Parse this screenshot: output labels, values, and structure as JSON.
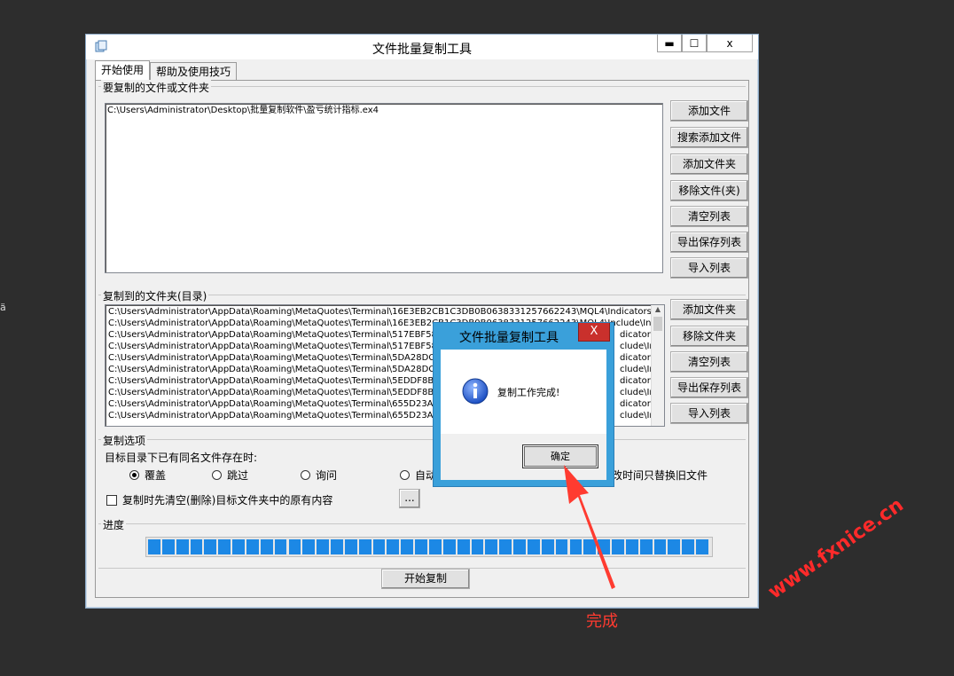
{
  "window": {
    "title": "文件批量复制工具",
    "controls": {
      "minimize": "▬",
      "maximize": "☐",
      "close": "x"
    }
  },
  "edge_text": "ä",
  "tabs": [
    {
      "label": "开始使用",
      "active": true
    },
    {
      "label": "帮助及使用技巧",
      "active": false
    }
  ],
  "source_group": {
    "label": "要复制的文件或文件夹",
    "items": [
      "C:\\Users\\Administrator\\Desktop\\批量复制软件\\盈亏统计指标.ex4"
    ],
    "buttons": [
      "添加文件",
      "搜索添加文件",
      "添加文件夹",
      "移除文件(夹)",
      "清空列表",
      "导出保存列表",
      "导入列表"
    ]
  },
  "dest_group": {
    "label": "复制到的文件夹(目录)",
    "items": [
      "C:\\Users\\Administrator\\AppData\\Roaming\\MetaQuotes\\Terminal\\16E3EB2CB1C3DB0B0638331257662243\\MQL4\\Indicators",
      "C:\\Users\\Administrator\\AppData\\Roaming\\MetaQuotes\\Terminal\\16E3EB2CB1C3DB0B0638331257662243\\MQL4\\Include\\Ind",
      "C:\\Users\\Administrator\\AppData\\Roaming\\MetaQuotes\\Terminal\\517EBF58E",
      "C:\\Users\\Administrator\\AppData\\Roaming\\MetaQuotes\\Terminal\\517EBF58E",
      "C:\\Users\\Administrator\\AppData\\Roaming\\MetaQuotes\\Terminal\\5DA28DC0",
      "C:\\Users\\Administrator\\AppData\\Roaming\\MetaQuotes\\Terminal\\5DA28DC0",
      "C:\\Users\\Administrator\\AppData\\Roaming\\MetaQuotes\\Terminal\\5EDDF8BF",
      "C:\\Users\\Administrator\\AppData\\Roaming\\MetaQuotes\\Terminal\\5EDDF8BF",
      "C:\\Users\\Administrator\\AppData\\Roaming\\MetaQuotes\\Terminal\\655D23AF",
      "C:\\Users\\Administrator\\AppData\\Roaming\\MetaQuotes\\Terminal\\655D23AF"
    ],
    "right_fragments": [
      "dicators",
      "clude\\In",
      "dicators",
      "clude\\Inc",
      "dicators",
      "clude\\Inc",
      "dicators",
      "clude\\Inc"
    ],
    "buttons": [
      "添加文件夹",
      "移除文件夹",
      "清空列表",
      "导出保存列表",
      "导入列表"
    ]
  },
  "options": {
    "label": "复制选项",
    "prompt": "目标目录下已有同名文件存在时:",
    "radios": [
      {
        "label": "覆盖",
        "checked": true
      },
      {
        "label": "跳过",
        "checked": false
      },
      {
        "label": "询问",
        "checked": false
      },
      {
        "label": "自动",
        "checked": false
      }
    ],
    "radio_tail": "改时间只替换旧文件",
    "clear_checkbox": "复制时先清空(删除)目标文件夹中的原有内容",
    "more_button": "..."
  },
  "progress": {
    "label": "进度",
    "percent": 100,
    "segments": 40,
    "color": "#1c88e5"
  },
  "start_button": "开始复制",
  "dialog": {
    "title": "文件批量复制工具",
    "close": "X",
    "message": "复制工作完成!",
    "ok": "确定",
    "icon": "info-icon"
  },
  "annotation": {
    "text": "完成",
    "color": "#ff3b30"
  },
  "watermark": "www.fxnice.cn"
}
